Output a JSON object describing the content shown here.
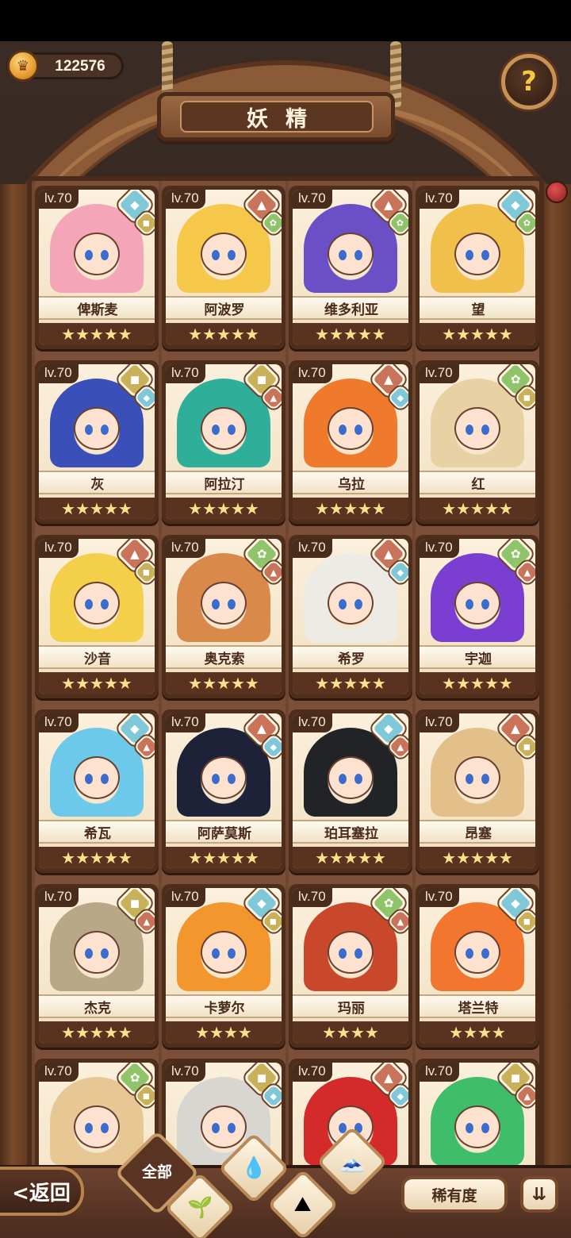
{
  "header": {
    "coins": "122576",
    "title": "妖精",
    "help_symbol": "?"
  },
  "fairies": [
    {
      "level": "lv.70",
      "name": "俾斯麦",
      "stars": "★★★★★",
      "element": "water",
      "sub_element": "earth",
      "hair": "#f4a6b8"
    },
    {
      "level": "lv.70",
      "name": "阿波罗",
      "stars": "★★★★★",
      "element": "fire",
      "sub_element": "wood",
      "hair": "#f5c84a"
    },
    {
      "level": "lv.70",
      "name": "维多利亚",
      "stars": "★★★★★",
      "element": "fire",
      "sub_element": "wood",
      "hair": "#6a4fc7"
    },
    {
      "level": "lv.70",
      "name": "望",
      "stars": "★★★★★",
      "element": "water",
      "sub_element": "wood",
      "hair": "#f0c04a"
    },
    {
      "level": "lv.70",
      "name": "灰",
      "stars": "★★★★★",
      "element": "earth",
      "sub_element": "water",
      "hair": "#3a4fb8"
    },
    {
      "level": "lv.70",
      "name": "阿拉汀",
      "stars": "★★★★★",
      "element": "earth",
      "sub_element": "fire",
      "hair": "#2fae9a"
    },
    {
      "level": "lv.70",
      "name": "乌拉",
      "stars": "★★★★★",
      "element": "fire",
      "sub_element": "water",
      "hair": "#ef7a2c"
    },
    {
      "level": "lv.70",
      "name": "红",
      "stars": "★★★★★",
      "element": "wood",
      "sub_element": "earth",
      "hair": "#e8d2a4"
    },
    {
      "level": "lv.70",
      "name": "沙音",
      "stars": "★★★★★",
      "element": "fire",
      "sub_element": "earth",
      "hair": "#f3cf4a"
    },
    {
      "level": "lv.70",
      "name": "奥克索",
      "stars": "★★★★★",
      "element": "wood",
      "sub_element": "fire",
      "hair": "#d98a4a"
    },
    {
      "level": "lv.70",
      "name": "希罗",
      "stars": "★★★★★",
      "element": "fire",
      "sub_element": "water",
      "hair": "#ecebe6"
    },
    {
      "level": "lv.70",
      "name": "宇迦",
      "stars": "★★★★★",
      "element": "wood",
      "sub_element": "fire",
      "hair": "#7a3fd0"
    },
    {
      "level": "lv.70",
      "name": "希瓦",
      "stars": "★★★★★",
      "element": "water",
      "sub_element": "fire",
      "hair": "#6cc9ea"
    },
    {
      "level": "lv.70",
      "name": "阿萨莫斯",
      "stars": "★★★★★",
      "element": "fire",
      "sub_element": "water",
      "hair": "#1e2238"
    },
    {
      "level": "lv.70",
      "name": "珀耳塞拉",
      "stars": "★★★★★",
      "element": "water",
      "sub_element": "fire",
      "hair": "#222326"
    },
    {
      "level": "lv.70",
      "name": "昂塞",
      "stars": "★★★★★",
      "element": "fire",
      "sub_element": "earth",
      "hair": "#e3c08a"
    },
    {
      "level": "lv.70",
      "name": "杰克",
      "stars": "★★★★★",
      "element": "earth",
      "sub_element": "fire",
      "hair": "#b8a888"
    },
    {
      "level": "lv.70",
      "name": "卡萝尔",
      "stars": "★★★★",
      "element": "water",
      "sub_element": "earth",
      "hair": "#f3962e"
    },
    {
      "level": "lv.70",
      "name": "玛丽",
      "stars": "★★★★",
      "element": "wood",
      "sub_element": "fire",
      "hair": "#c9472a"
    },
    {
      "level": "lv.70",
      "name": "塔兰特",
      "stars": "★★★★",
      "element": "water",
      "sub_element": "earth",
      "hair": "#f2762e"
    },
    {
      "level": "lv.70",
      "name": "",
      "stars": "",
      "element": "wood",
      "sub_element": "earth",
      "hair": "#e7c894"
    },
    {
      "level": "lv.70",
      "name": "",
      "stars": "",
      "element": "earth",
      "sub_element": "water",
      "hair": "#d8d6d0"
    },
    {
      "level": "lv.70",
      "name": "",
      "stars": "",
      "element": "fire",
      "sub_element": "water",
      "hair": "#d42a2a"
    },
    {
      "level": "lv.70",
      "name": "",
      "stars": "",
      "element": "earth",
      "sub_element": "fire",
      "hair": "#3ebd6a"
    }
  ],
  "element_colors": {
    "water": "#7fc8d8",
    "fire": "#c9735a",
    "wood": "#8fc46a",
    "earth": "#c9b15a"
  },
  "element_icons": {
    "water": "droplet-icon",
    "fire": "flame-mountain-icon",
    "wood": "sprout-icon",
    "earth": "rock-icon"
  },
  "footer": {
    "back_label": "<返回",
    "filter_all_label": "全部",
    "sort_label": "稀有度",
    "order_symbol": "⇊"
  }
}
